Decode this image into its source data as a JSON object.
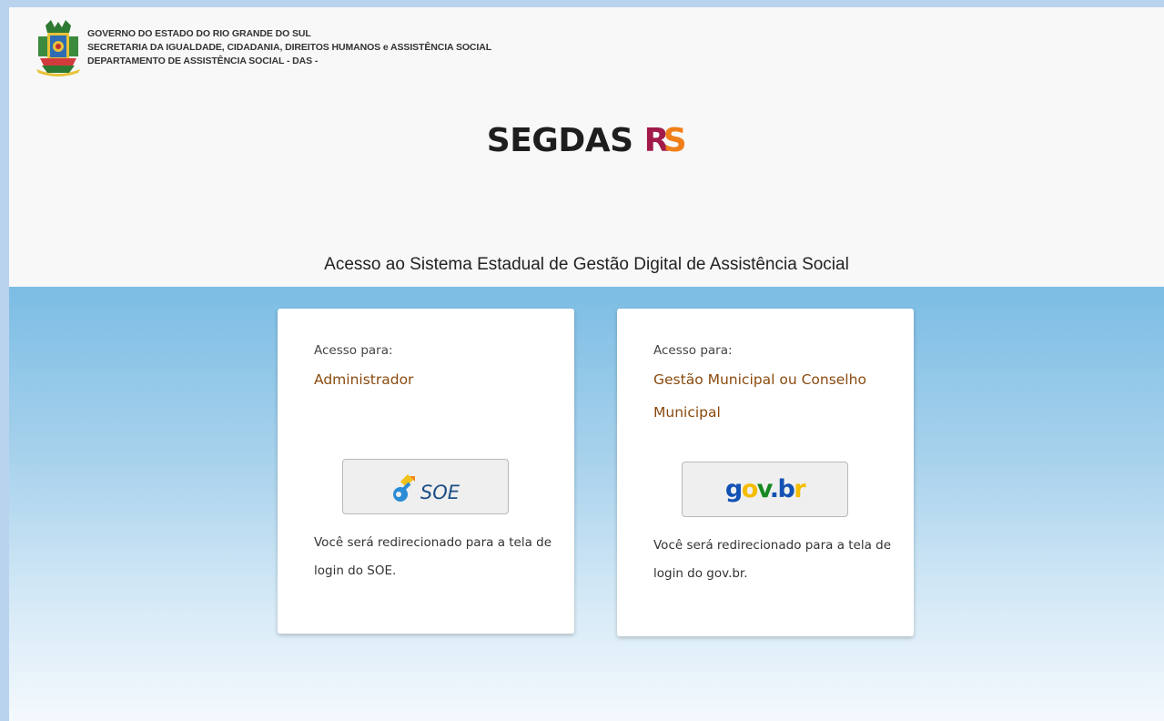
{
  "header": {
    "lines": [
      "GOVERNO DO ESTADO DO RIO GRANDE DO SUL",
      "SECRETARIA DA IGUALDADE, CIDADANIA, DIREITOS HUMANOS e ASSISTÊNCIA SOCIAL",
      "DEPARTAMENTO DE ASSISTÊNCIA SOCIAL - DAS -"
    ],
    "crest_icon": "rs-coat-of-arms-icon"
  },
  "brand": {
    "main": "SEGDAS",
    "r": "R",
    "s": "S",
    "colors": {
      "main": "#1e1e1e",
      "r": "#a11a4a",
      "s": "#f07f1a"
    }
  },
  "subtitle": "Acesso ao Sistema Estadual de Gestão Digital de Assistência Social",
  "cards": [
    {
      "label": "Acesso para:",
      "role": "Administrador",
      "button": {
        "logo_text": "SOE",
        "icon": "soe-key-icon"
      },
      "note": "Você será redirecionado para a tela de login do SOE."
    },
    {
      "label": "Acesso para:",
      "role": "Gestão Municipal ou Conselho Municipal",
      "button": {
        "logo_parts": [
          "g",
          "o",
          "v",
          ".",
          "b",
          "r"
        ],
        "icon": "govbr-logo-icon"
      },
      "note": "Você será redirecionado para a tela de login do gov.br."
    }
  ]
}
